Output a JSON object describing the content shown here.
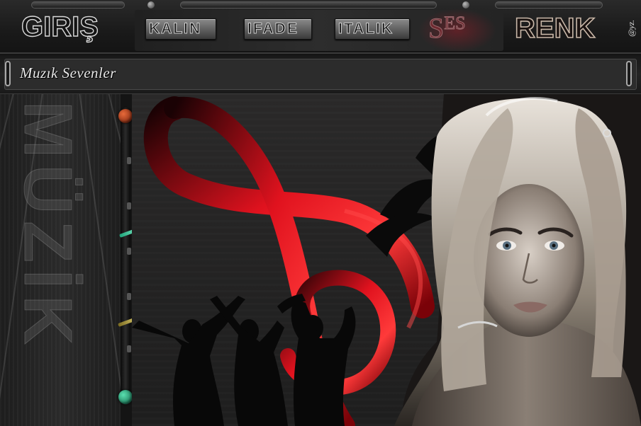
{
  "toolbar": {
    "logo": "GIRIŞ",
    "buttons": {
      "bold": "KALIN",
      "emote": "IFADE",
      "italic": "ITALIK",
      "sound_big": "S",
      "sound_small": "ES",
      "color": "RENK"
    },
    "signature": "@yz."
  },
  "title_bar": {
    "room_name": "Muzık Sevenler"
  },
  "left_panel": {
    "decor_text": "MÜZİK"
  },
  "colors": {
    "accent_red": "#d0101c",
    "scroll_up": "#e86a3a",
    "scroll_down": "#2fbf8f"
  },
  "icons": [
    "treble-clef-icon",
    "dancers-silhouette",
    "woman-portrait"
  ]
}
